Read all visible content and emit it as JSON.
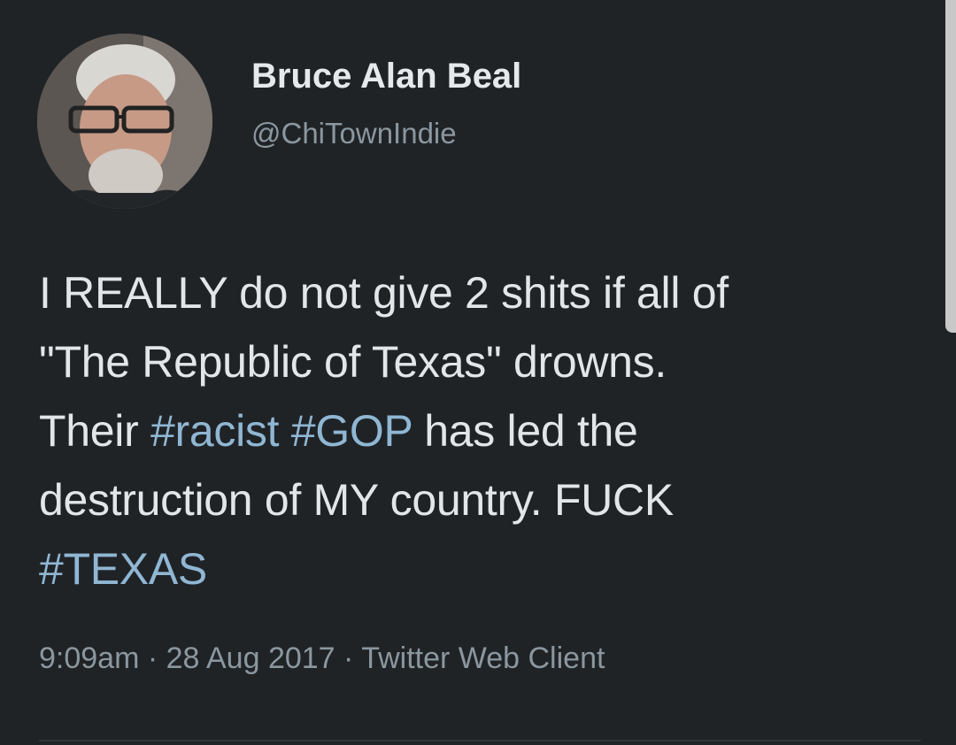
{
  "user": {
    "display_name": "Bruce Alan Beal",
    "handle": "@ChiTownIndie",
    "avatar_icon": "profile-photo"
  },
  "tweet": {
    "lines": [
      [
        {
          "text": "I REALLY do not give 2 shits if all of",
          "hashtag": false
        }
      ],
      [
        {
          "text": "\"The Republic of Texas\" drowns.",
          "hashtag": false
        }
      ],
      [
        {
          "text": "Their ",
          "hashtag": false
        },
        {
          "text": "#racist",
          "hashtag": true
        },
        {
          "text": " ",
          "hashtag": false
        },
        {
          "text": "#GOP",
          "hashtag": true
        },
        {
          "text": " has led the",
          "hashtag": false
        }
      ],
      [
        {
          "text": "destruction of MY country. FUCK",
          "hashtag": false
        }
      ],
      [
        {
          "text": "#TEXAS",
          "hashtag": true
        }
      ]
    ],
    "meta": "9:09am · 28 Aug 2017 · Twitter Web Client"
  },
  "colors": {
    "background": "#202326",
    "text": "#e3e6e9",
    "hashtag": "#8fb7d4",
    "secondary": "#8b979f"
  }
}
